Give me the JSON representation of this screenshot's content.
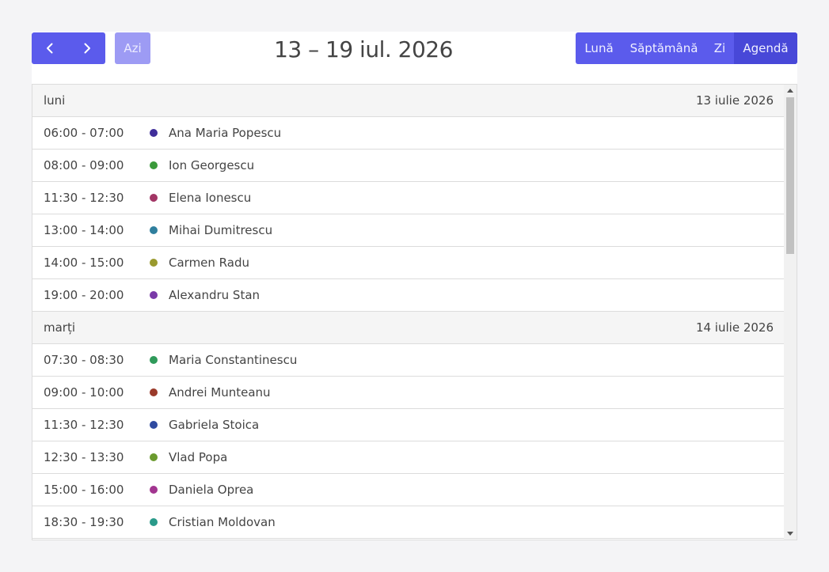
{
  "toolbar": {
    "today_label": "Azi",
    "title": "13 – 19 iul. 2026",
    "views": [
      "Lună",
      "Săptămână",
      "Zi",
      "Agendă"
    ],
    "active_view": "Agendă",
    "accent_color": "#5b5bec",
    "active_color": "#4848d8"
  },
  "days": [
    {
      "weekday": "luni",
      "date": "13 iulie 2026",
      "events": [
        {
          "time": "06:00 - 07:00",
          "name": "Ana Maria Popescu",
          "color": "#3f2e9a"
        },
        {
          "time": "08:00 - 09:00",
          "name": "Ion Georgescu",
          "color": "#3a9a3a"
        },
        {
          "time": "11:30 - 12:30",
          "name": "Elena Ionescu",
          "color": "#a23565"
        },
        {
          "time": "13:00 - 14:00",
          "name": "Mihai Dumitrescu",
          "color": "#2f7f9e"
        },
        {
          "time": "14:00 - 15:00",
          "name": "Carmen Radu",
          "color": "#9a9a2e"
        },
        {
          "time": "19:00 - 20:00",
          "name": "Alexandru Stan",
          "color": "#7a3aa8"
        }
      ]
    },
    {
      "weekday": "marți",
      "date": "14 iulie 2026",
      "events": [
        {
          "time": "07:30 - 08:30",
          "name": "Maria Constantinescu",
          "color": "#2f9a5a"
        },
        {
          "time": "09:00 - 10:00",
          "name": "Andrei Munteanu",
          "color": "#9a3a2a"
        },
        {
          "time": "11:30 - 12:30",
          "name": "Gabriela Stoica",
          "color": "#2f4aa0"
        },
        {
          "time": "12:30 - 13:30",
          "name": "Vlad Popa",
          "color": "#6a9a2e"
        },
        {
          "time": "15:00 - 16:00",
          "name": "Daniela Oprea",
          "color": "#a23590"
        },
        {
          "time": "18:30 - 19:30",
          "name": "Cristian Moldovan",
          "color": "#2a9a8a"
        }
      ]
    }
  ]
}
